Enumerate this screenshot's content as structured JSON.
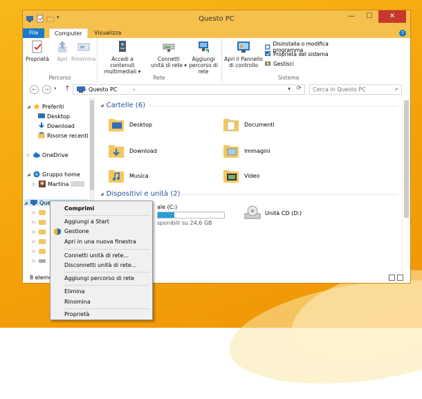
{
  "window": {
    "title": "Questo PC",
    "controls": {
      "minimize": "—",
      "maximize": "☐",
      "close": "✕"
    }
  },
  "ribbon": {
    "tabs": [
      "File",
      "Computer",
      "Visualizza"
    ],
    "help": "?",
    "groups": {
      "percorso": {
        "label": "Percorso",
        "buttons": [
          "Proprietà",
          "Apri",
          "Rinomina"
        ]
      },
      "rete": {
        "label": "Rete",
        "buttons": [
          {
            "line1": "Accedi a contenuti",
            "line2": "multimediali ▾"
          },
          {
            "line1": "Connetti",
            "line2": "unità di rete ▾"
          },
          {
            "line1": "Aggiungi",
            "line2": "percorso di rete"
          }
        ]
      },
      "sistema": {
        "label": "Sistema",
        "big": {
          "line1": "Apri il Pannello",
          "line2": "di controllo"
        },
        "small": [
          "Disinstalla o modifica programma",
          "Proprietà del sistema",
          "Gestisci"
        ]
      }
    }
  },
  "address": {
    "path": "Questo PC",
    "chevron": "›",
    "search_placeholder": "Cerca in Questo PC"
  },
  "nav": {
    "favorites": "Preferiti",
    "fav_items": [
      "Desktop",
      "Download",
      "Risorse recenti"
    ],
    "onedrive": "OneDrive",
    "homegroup": "Gruppo home",
    "homegroup_user": "Martina",
    "this_pc": "Questo PC"
  },
  "content": {
    "folders_header": "Cartelle (6)",
    "folders": [
      "Desktop",
      "Documenti",
      "Download",
      "Immagini",
      "Musica",
      "Video"
    ],
    "devices_header": "Dispositivi e unità (2)",
    "drive_c": {
      "name_fragment": "ale (C:)",
      "space_fragment": "sponibili su 24,6 GB",
      "used_fraction": 0.25
    },
    "drive_d": "Unità CD (D:)"
  },
  "status": {
    "count": "8 eleme"
  },
  "context_menu": [
    "Comprimi",
    "Aggiungi a Start",
    "Gestione",
    "Apri in una nuova finestra",
    "Connetti unità di rete...",
    "Disconnetti unità di rete...",
    "Aggiungi percorso di rete",
    "Elimina",
    "Rinomina",
    "Proprietà"
  ],
  "colors": {
    "titlebar": "#f6c04d",
    "file_tab": "#1979ca",
    "header_text": "#1f4e9c",
    "folder": "#f3c75f",
    "drive_bar": "#26a0da"
  }
}
